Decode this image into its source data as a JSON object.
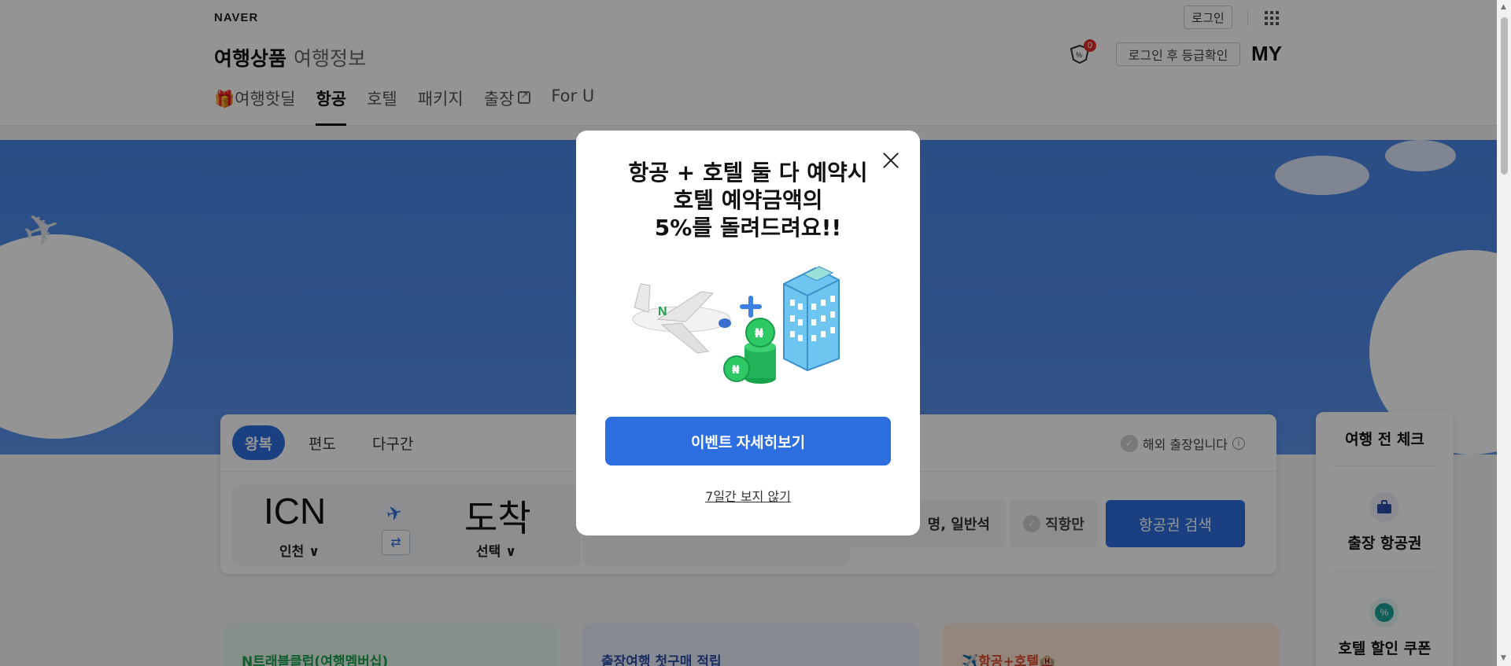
{
  "header": {
    "brand": "NAVER",
    "title_main": "여행상품",
    "title_sub": "여행정보",
    "login_label": "로그인",
    "coupon_count": "0",
    "grade_label": "로그인 후 등급확인",
    "my_label": "MY"
  },
  "nav": {
    "items": [
      {
        "label": "🎁여행핫딜"
      },
      {
        "label": "항공"
      },
      {
        "label": "호텔"
      },
      {
        "label": "패키지"
      },
      {
        "label": "출장"
      },
      {
        "label": "For U"
      }
    ],
    "active_index": 1
  },
  "search": {
    "tabs": [
      "왕복",
      "편도",
      "다구간"
    ],
    "abroad_label": "해외 출장입니다",
    "info_glyph": "i",
    "departure_code": "ICN",
    "departure_name": "인천 ∨",
    "arrival_code": "도착",
    "arrival_name": "선택 ∨",
    "swap_glyph": "⇄",
    "passenger_label": "명, 일반석",
    "direct_label": "직항만",
    "search_button": "항공권 검색"
  },
  "side_widget": {
    "title": "여행 전 체크",
    "items": [
      "출장 항공권",
      "호텔 할인 쿠폰"
    ],
    "coupon_glyph": "%"
  },
  "promos": [
    {
      "title": "N트래블클럽(여행멤버십)",
      "color": "#1aa34a"
    },
    {
      "title": "출장여행 첫구매 적립",
      "color": "#2a4fa8"
    },
    {
      "title": "✈️항공+호텔🏨",
      "color": "#e04a2a"
    }
  ],
  "modal": {
    "title_line1": "항공 + 호텔 둘 다 예약시",
    "title_line2": "호텔 예약금액의",
    "title_line3": "5%를 돌려드려요!!",
    "cta_label": "이벤트 자세히보기",
    "skip_label": "7일간 보지 않기",
    "plane_mark": "N",
    "coin_mark": "₦"
  },
  "colors": {
    "accent": "#2d6ee0",
    "hero_blue": "#4a86e6",
    "badge_red": "#e12e2e"
  }
}
